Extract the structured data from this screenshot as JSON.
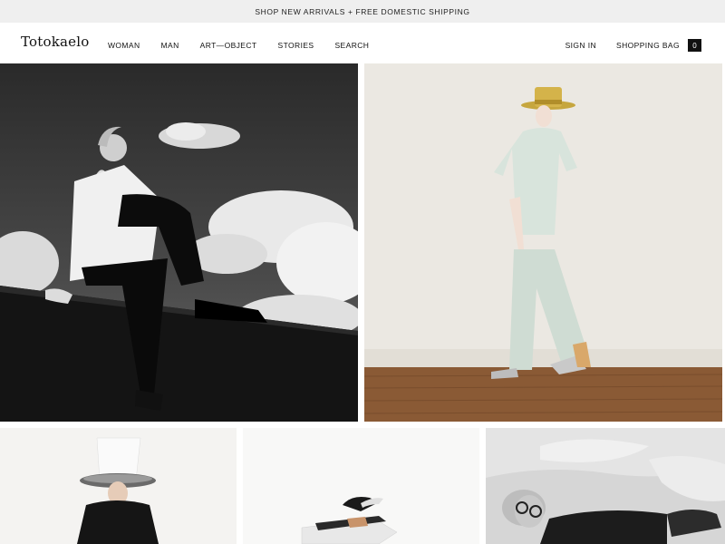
{
  "promo": {
    "text": "SHOP NEW ARRIVALS + FREE DOMESTIC SHIPPING"
  },
  "header": {
    "logo": "Totokaelo",
    "nav": [
      "WOMAN",
      "MAN",
      "ART—OBJECT",
      "STORIES",
      "SEARCH"
    ],
    "sign_in": "SIGN IN",
    "bag_label": "SHOPPING BAG",
    "bag_count": "0"
  },
  "tiles": [
    {
      "name": "editorial-sky",
      "subject": "woman seated on ledge against cloudy sky, black & white"
    },
    {
      "name": "editorial-studio",
      "subject": "model in straw hat and mint dress on wooden floor"
    },
    {
      "name": "product-hat",
      "subject": "white wide-brim hat"
    },
    {
      "name": "product-sandal",
      "subject": "platform sandal"
    },
    {
      "name": "editorial-bed",
      "subject": "woman with sunglasses lying on bed, black & white"
    }
  ],
  "colors": {
    "promo_bg": "#efefef",
    "text": "#111111",
    "badge_bg": "#111111"
  }
}
